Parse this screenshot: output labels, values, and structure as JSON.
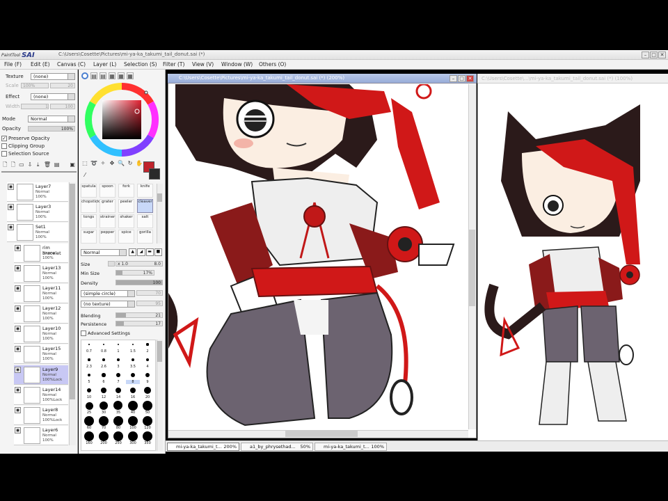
{
  "app": {
    "logo_small": "PaintTool",
    "logo_big": "SAI",
    "title": "C:\\Users\\Cosette\\Pictures\\mi-ya-ka_takumi_tail_donut.sai (*)"
  },
  "menu": [
    "File (F)",
    "Edit (E)",
    "Canvas (C)",
    "Layer (L)",
    "Selection (S)",
    "Filter (T)",
    "View (V)",
    "Window (W)",
    "Others (O)"
  ],
  "left": {
    "texture_label": "Texture",
    "texture_value": "(none)",
    "scale_label": "Scale",
    "scale_value": "100%",
    "scale_value2": "20",
    "effect_label": "Effect",
    "effect_value": "(none)",
    "width_label": "Width",
    "width_value": "1",
    "width_value2": "100",
    "mode_label": "Mode",
    "mode_value": "Normal",
    "opacity_label": "Opacity",
    "opacity_value": "100%",
    "preserve_opacity": "Preserve Opacity",
    "clipping_group": "Clipping Group",
    "selection_source": "Selection Source"
  },
  "layers": [
    {
      "name": "Layer7",
      "mode": "Normal",
      "opacity": "100%"
    },
    {
      "name": "Layer3",
      "mode": "Normal",
      "opacity": "100%"
    },
    {
      "name": "Set1",
      "mode": "Normal",
      "opacity": "100%"
    },
    {
      "name": "rim bracelet",
      "mode": "Normal",
      "opacity": "100%"
    },
    {
      "name": "Layer13",
      "mode": "Normal",
      "opacity": "100%"
    },
    {
      "name": "Layer11",
      "mode": "Normal",
      "opacity": "100%"
    },
    {
      "name": "Layer12",
      "mode": "Normal",
      "opacity": "100%"
    },
    {
      "name": "Layer10",
      "mode": "Normal",
      "opacity": "100%"
    },
    {
      "name": "Layer15",
      "mode": "Normal",
      "opacity": "100%"
    },
    {
      "name": "Layer9",
      "mode": "Normal",
      "opacity": "100%Lock"
    },
    {
      "name": "Layer14",
      "mode": "Normal",
      "opacity": "100%Lock"
    },
    {
      "name": "Layer8",
      "mode": "Normal",
      "opacity": "100%Lock"
    },
    {
      "name": "Layer6",
      "mode": "Normal",
      "opacity": "100%"
    }
  ],
  "brushes": [
    [
      "spatula",
      "spoon",
      "fork",
      "knife"
    ],
    [
      "chopstick",
      "grater",
      "peeler",
      "cleaver"
    ],
    [
      "tongs",
      "strainer",
      "shaker",
      "salt"
    ],
    [
      "sugar",
      "pepper",
      "spice",
      "gorilla"
    ]
  ],
  "tool": {
    "blend_mode": "Normal",
    "size_label": "Size",
    "size_mult": "x 1.0",
    "size_value": "8.0",
    "min_size_label": "Min Size",
    "min_size_value": "17%",
    "density_label": "Density",
    "density_value": "100",
    "shape": "(simple circle)",
    "shape_val": "70",
    "texture": "(no texture)",
    "texture_val": "95",
    "blending_label": "Blending",
    "blending_value": "21",
    "persistence_label": "Persistence",
    "persistence_value": "17",
    "advanced": "Advanced Settings"
  },
  "sizes": [
    [
      "0.7",
      "0.8",
      "1",
      "1.5",
      "2"
    ],
    [
      "2.3",
      "2.6",
      "3",
      "3.5",
      "4"
    ],
    [
      "5",
      "6",
      "7",
      "8",
      "9"
    ],
    [
      "10",
      "12",
      "14",
      "16",
      "20"
    ],
    [
      "25",
      "30",
      "35",
      "40",
      "50"
    ],
    [
      "60",
      "70",
      "80",
      "100",
      "120"
    ],
    [
      "160",
      "200",
      "250",
      "300",
      "350"
    ]
  ],
  "canvas": {
    "title": "C:\\Users\\Cosette\\Pictures\\mi-ya-ka_takumi_tail_donut.sai (*) (200%)"
  },
  "second": {
    "title": "C:\\Users\\Cosette\\...\\mi-ya-ka_takumi_tail_donut.sai (*) (100%)"
  },
  "tabs": [
    {
      "name": "mi-ya-ka_takumi_t...",
      "zoom": "200%"
    },
    {
      "name": "a1_by_phrysethad...",
      "zoom": "50%"
    },
    {
      "name": "mi-ya-ka_takumi_t...",
      "zoom": "100%"
    }
  ],
  "colors": {
    "primary": "#c0242c",
    "secondary": "#2a2a2a",
    "accent": "#d01818"
  }
}
